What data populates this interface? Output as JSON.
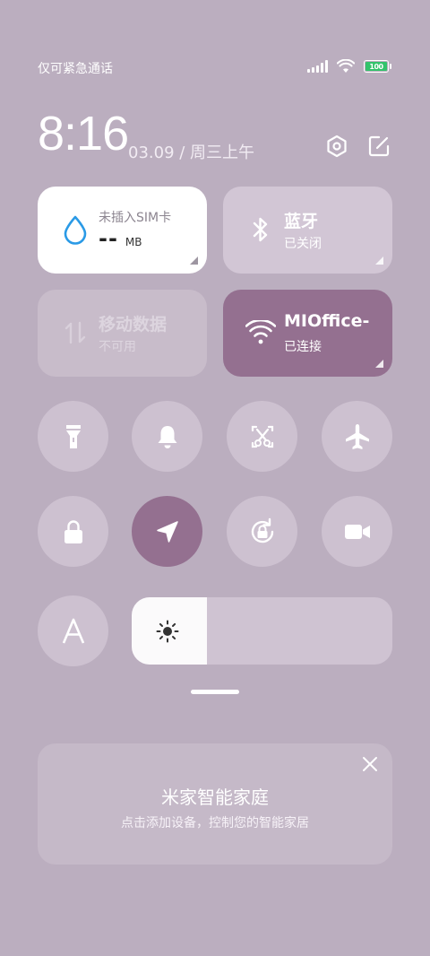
{
  "status": {
    "carrier_text": "仅可紧急通话",
    "battery_level": "100",
    "battery_percent": 100
  },
  "header": {
    "time": "8:16",
    "date": "03.09 / 周三上午"
  },
  "tiles": {
    "sim": {
      "title": "未插入SIM卡",
      "value": "--",
      "unit": "MB"
    },
    "bluetooth": {
      "title": "蓝牙",
      "status": "已关闭"
    },
    "mobile_data": {
      "title": "移动数据",
      "status": "不可用"
    },
    "wifi": {
      "title": "MIOffice-",
      "status": "已连接"
    }
  },
  "toggles": {
    "flashlight": false,
    "silent": false,
    "screenshot": false,
    "airplane": false,
    "lock": false,
    "location": true,
    "rotation_lock": false,
    "screen_record": false,
    "auto_brightness": false
  },
  "brightness": {
    "level": 0.29
  },
  "smart_home": {
    "title": "米家智能家庭",
    "subtitle": "点击添加设备，控制您的智能家居"
  },
  "colors": {
    "background": "#bbaebf",
    "tile_active": "#947090",
    "tile_inactive": "#d2c6d5",
    "water_icon": "#2a9ae6",
    "battery_green": "#33c36b"
  }
}
